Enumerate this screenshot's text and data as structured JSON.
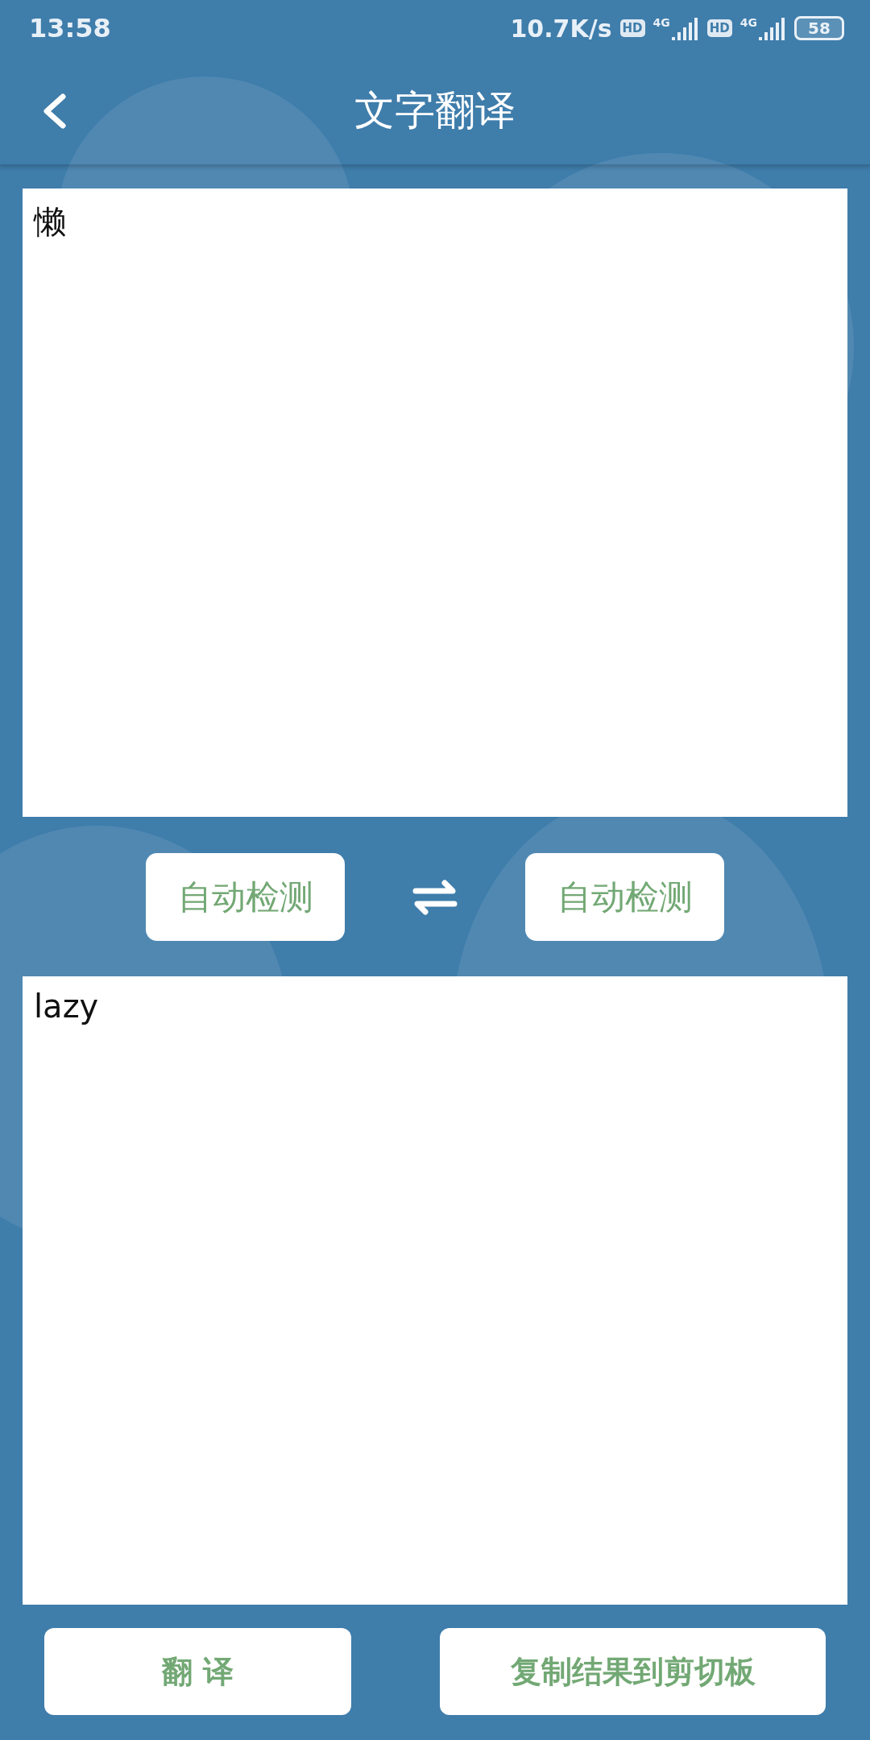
{
  "status_bar": {
    "time": "13:58",
    "net_speed": "10.7K/s",
    "sim_slots": [
      {
        "hd": "HD",
        "network": "4G"
      },
      {
        "hd": "HD",
        "network": "4G"
      }
    ],
    "battery": "58"
  },
  "app_bar": {
    "title": "文字翻译"
  },
  "source": {
    "value": "懒"
  },
  "languages": {
    "from": "自动检测",
    "to": "自动检测"
  },
  "result": {
    "value": "lazy"
  },
  "buttons": [
    {
      "kind": "translate",
      "label": "翻 译"
    },
    {
      "kind": "copy",
      "label": "复制结果到剪切板"
    }
  ]
}
